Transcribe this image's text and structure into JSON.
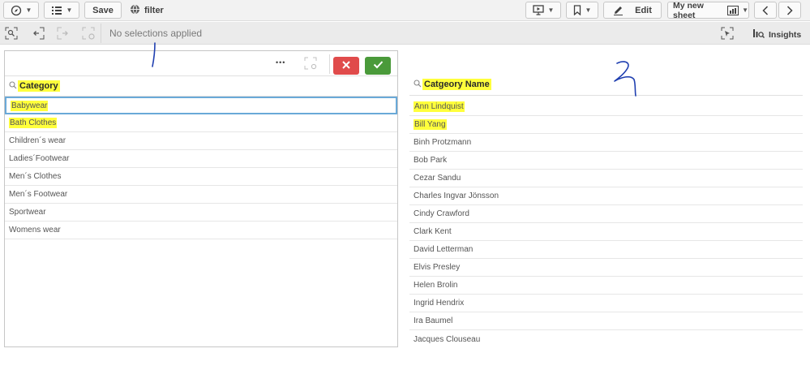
{
  "toolbar": {
    "save_label": "Save",
    "app_name": "filter",
    "edit_label": "Edit",
    "sheet_name": "My new sheet"
  },
  "selection_bar": {
    "status": "No selections applied",
    "insights_label": "Insights"
  },
  "left_pane": {
    "title": "Category",
    "more_label": "•••",
    "items": [
      "Babywear",
      "Bath Clothes",
      "Children´s wear",
      "Ladies´Footwear",
      "Men´s Clothes",
      "Men´s Footwear",
      "Sportwear",
      "Womens wear"
    ]
  },
  "right_pane": {
    "title": "Catgeory Name",
    "items": [
      "Ann Lindquist",
      "Bill Yang",
      "Binh Protzmann",
      "Bob Park",
      "Cezar Sandu",
      "Charles Ingvar Jönsson",
      "Cindy Crawford",
      "Clark Kent",
      "David Letterman",
      "Elvis Presley",
      "Helen Brolin",
      "Ingrid Hendrix",
      "Ira Baumel",
      "Jacques Clouseau"
    ]
  },
  "annotations": {
    "mark_1": "1",
    "mark_2": "2"
  },
  "colors": {
    "highlight": "#ffff3c",
    "cancel": "#e04b4b",
    "confirm": "#4a9a3a",
    "selected_border": "#6aa9d8",
    "annotation_ink": "#1f3fb0"
  }
}
